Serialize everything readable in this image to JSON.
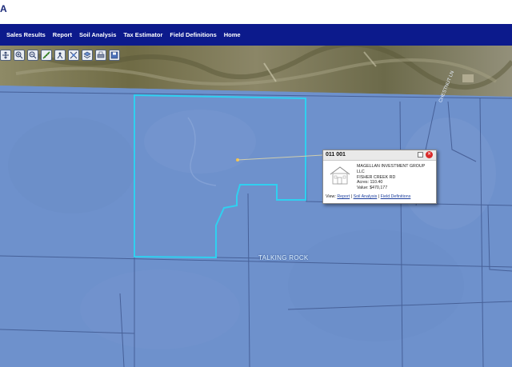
{
  "header": {
    "logo_fragment": "A"
  },
  "nav": {
    "items": [
      {
        "label": "Sales Results"
      },
      {
        "label": "Report"
      },
      {
        "label": "Soil Analysis"
      },
      {
        "label": "Tax Estimator"
      },
      {
        "label": "Field Definitions"
      },
      {
        "label": "Home"
      }
    ]
  },
  "toolbar": {
    "tools": [
      {
        "icon": "pan-icon"
      },
      {
        "icon": "zoom-in-icon"
      },
      {
        "icon": "zoom-out-icon"
      },
      {
        "icon": "measure-icon"
      },
      {
        "icon": "identify-icon"
      },
      {
        "icon": "full-extent-icon"
      },
      {
        "icon": "layers-icon"
      },
      {
        "icon": "print-icon"
      },
      {
        "icon": "save-icon"
      }
    ]
  },
  "map": {
    "road_label": "TALKING ROCK",
    "side_road_label": "CHESTNUT LN",
    "colors": {
      "overlay": "#6e91cc",
      "parcel_outline": "#2fd0f0",
      "parcel_lines": "#40588f"
    }
  },
  "popup": {
    "title": "011 001",
    "owner": "MAGELLAN INVESTMENT GROUP LLC",
    "address": "FISHER CREEK RD",
    "acres": "Acres: 110.40",
    "value": "Value: $470,177",
    "view_label": "View:",
    "links": [
      "Report",
      "Soil Analysis",
      "Field Definitions"
    ],
    "separator": " | "
  }
}
